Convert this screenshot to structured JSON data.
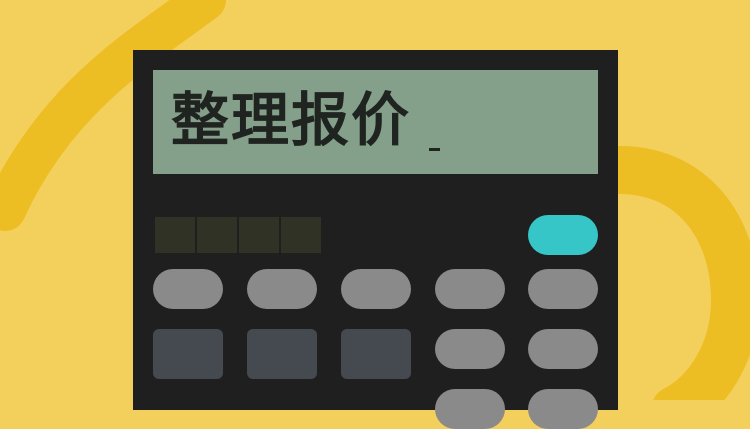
{
  "display": {
    "text": "整理报价"
  },
  "colors": {
    "background": "#f3cf5c",
    "background_swirl": "#edbd24",
    "calculator_body": "#1f1f1f",
    "lcd_screen": "#84a08a",
    "lcd_text": "#202420",
    "memory_segment": "#313226",
    "key_gray": "#8a8a8a",
    "key_dark": "#454950",
    "key_accent": "#37c6c8"
  }
}
